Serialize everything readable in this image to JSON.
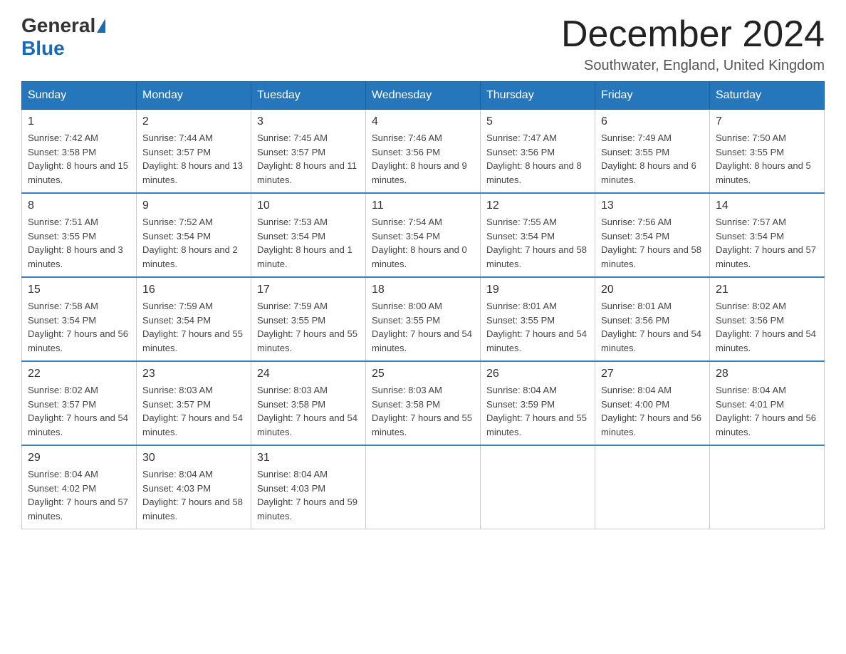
{
  "header": {
    "logo_general": "General",
    "logo_blue": "Blue",
    "month_title": "December 2024",
    "location": "Southwater, England, United Kingdom"
  },
  "days_of_week": [
    "Sunday",
    "Monday",
    "Tuesday",
    "Wednesday",
    "Thursday",
    "Friday",
    "Saturday"
  ],
  "weeks": [
    [
      {
        "day": "1",
        "sunrise": "7:42 AM",
        "sunset": "3:58 PM",
        "daylight": "8 hours and 15 minutes."
      },
      {
        "day": "2",
        "sunrise": "7:44 AM",
        "sunset": "3:57 PM",
        "daylight": "8 hours and 13 minutes."
      },
      {
        "day": "3",
        "sunrise": "7:45 AM",
        "sunset": "3:57 PM",
        "daylight": "8 hours and 11 minutes."
      },
      {
        "day": "4",
        "sunrise": "7:46 AM",
        "sunset": "3:56 PM",
        "daylight": "8 hours and 9 minutes."
      },
      {
        "day": "5",
        "sunrise": "7:47 AM",
        "sunset": "3:56 PM",
        "daylight": "8 hours and 8 minutes."
      },
      {
        "day": "6",
        "sunrise": "7:49 AM",
        "sunset": "3:55 PM",
        "daylight": "8 hours and 6 minutes."
      },
      {
        "day": "7",
        "sunrise": "7:50 AM",
        "sunset": "3:55 PM",
        "daylight": "8 hours and 5 minutes."
      }
    ],
    [
      {
        "day": "8",
        "sunrise": "7:51 AM",
        "sunset": "3:55 PM",
        "daylight": "8 hours and 3 minutes."
      },
      {
        "day": "9",
        "sunrise": "7:52 AM",
        "sunset": "3:54 PM",
        "daylight": "8 hours and 2 minutes."
      },
      {
        "day": "10",
        "sunrise": "7:53 AM",
        "sunset": "3:54 PM",
        "daylight": "8 hours and 1 minute."
      },
      {
        "day": "11",
        "sunrise": "7:54 AM",
        "sunset": "3:54 PM",
        "daylight": "8 hours and 0 minutes."
      },
      {
        "day": "12",
        "sunrise": "7:55 AM",
        "sunset": "3:54 PM",
        "daylight": "7 hours and 58 minutes."
      },
      {
        "day": "13",
        "sunrise": "7:56 AM",
        "sunset": "3:54 PM",
        "daylight": "7 hours and 58 minutes."
      },
      {
        "day": "14",
        "sunrise": "7:57 AM",
        "sunset": "3:54 PM",
        "daylight": "7 hours and 57 minutes."
      }
    ],
    [
      {
        "day": "15",
        "sunrise": "7:58 AM",
        "sunset": "3:54 PM",
        "daylight": "7 hours and 56 minutes."
      },
      {
        "day": "16",
        "sunrise": "7:59 AM",
        "sunset": "3:54 PM",
        "daylight": "7 hours and 55 minutes."
      },
      {
        "day": "17",
        "sunrise": "7:59 AM",
        "sunset": "3:55 PM",
        "daylight": "7 hours and 55 minutes."
      },
      {
        "day": "18",
        "sunrise": "8:00 AM",
        "sunset": "3:55 PM",
        "daylight": "7 hours and 54 minutes."
      },
      {
        "day": "19",
        "sunrise": "8:01 AM",
        "sunset": "3:55 PM",
        "daylight": "7 hours and 54 minutes."
      },
      {
        "day": "20",
        "sunrise": "8:01 AM",
        "sunset": "3:56 PM",
        "daylight": "7 hours and 54 minutes."
      },
      {
        "day": "21",
        "sunrise": "8:02 AM",
        "sunset": "3:56 PM",
        "daylight": "7 hours and 54 minutes."
      }
    ],
    [
      {
        "day": "22",
        "sunrise": "8:02 AM",
        "sunset": "3:57 PM",
        "daylight": "7 hours and 54 minutes."
      },
      {
        "day": "23",
        "sunrise": "8:03 AM",
        "sunset": "3:57 PM",
        "daylight": "7 hours and 54 minutes."
      },
      {
        "day": "24",
        "sunrise": "8:03 AM",
        "sunset": "3:58 PM",
        "daylight": "7 hours and 54 minutes."
      },
      {
        "day": "25",
        "sunrise": "8:03 AM",
        "sunset": "3:58 PM",
        "daylight": "7 hours and 55 minutes."
      },
      {
        "day": "26",
        "sunrise": "8:04 AM",
        "sunset": "3:59 PM",
        "daylight": "7 hours and 55 minutes."
      },
      {
        "day": "27",
        "sunrise": "8:04 AM",
        "sunset": "4:00 PM",
        "daylight": "7 hours and 56 minutes."
      },
      {
        "day": "28",
        "sunrise": "8:04 AM",
        "sunset": "4:01 PM",
        "daylight": "7 hours and 56 minutes."
      }
    ],
    [
      {
        "day": "29",
        "sunrise": "8:04 AM",
        "sunset": "4:02 PM",
        "daylight": "7 hours and 57 minutes."
      },
      {
        "day": "30",
        "sunrise": "8:04 AM",
        "sunset": "4:03 PM",
        "daylight": "7 hours and 58 minutes."
      },
      {
        "day": "31",
        "sunrise": "8:04 AM",
        "sunset": "4:03 PM",
        "daylight": "7 hours and 59 minutes."
      },
      null,
      null,
      null,
      null
    ]
  ]
}
